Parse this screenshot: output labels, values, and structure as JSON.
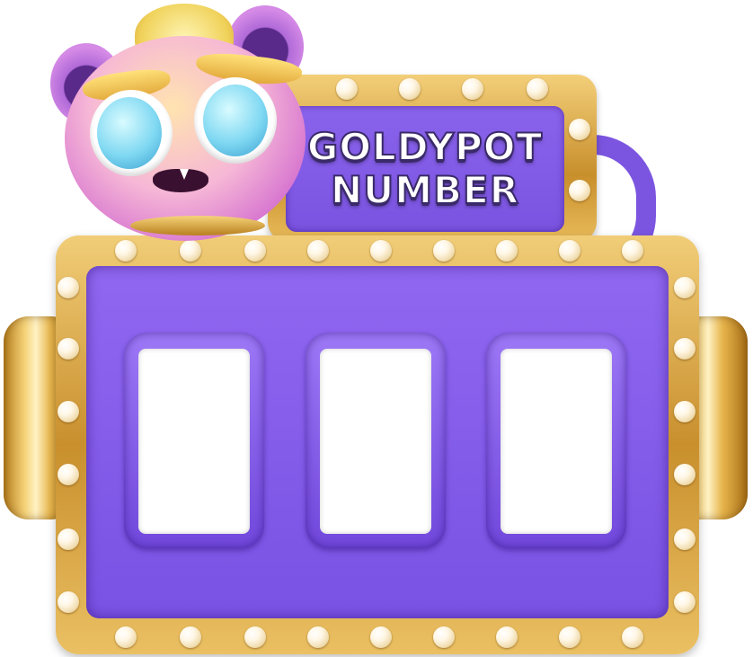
{
  "sign": {
    "line1": "GOLDYPOT",
    "line2": "NUMBER"
  },
  "slots": [
    {
      "value": ""
    },
    {
      "value": ""
    },
    {
      "value": ""
    }
  ],
  "colors": {
    "panel": "#7d55e6",
    "gold": "#d9a540",
    "slot": "#ffffff",
    "title_text": "#ffffff"
  },
  "icons": {
    "mascot": "pink-monster-mascot-icon",
    "bulb": "marquee-bulb-icon"
  }
}
